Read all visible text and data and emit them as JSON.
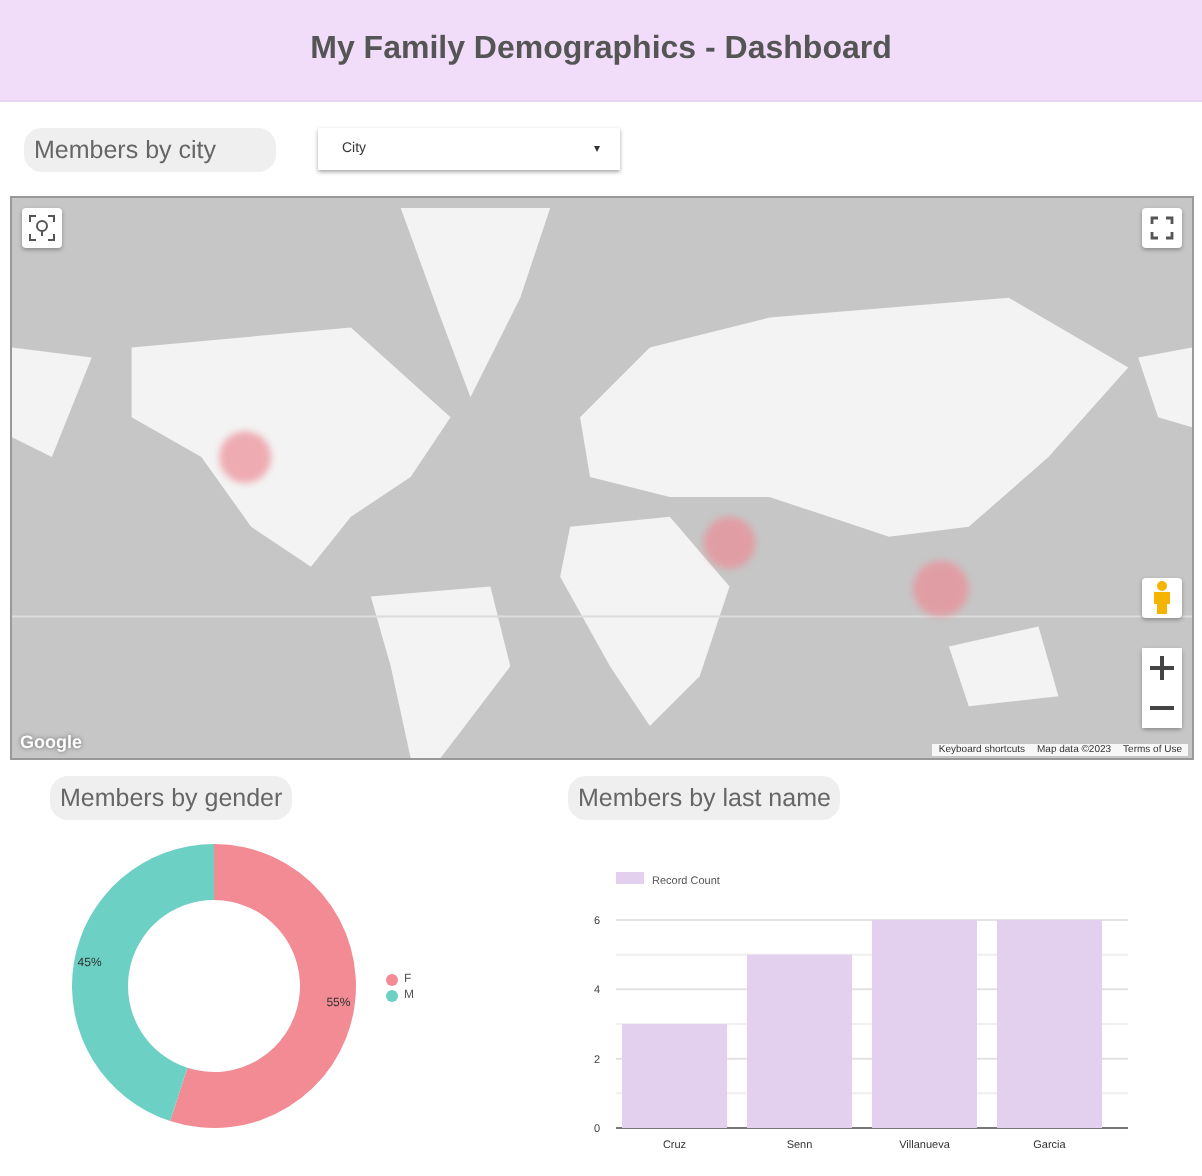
{
  "header": {
    "title": "My Family Demographics - Dashboard"
  },
  "city_section": {
    "title": "Members by city",
    "dropdown": {
      "value": "City",
      "caret": "▾"
    }
  },
  "map": {
    "kind": "picture",
    "logo": "Google",
    "attribution": [
      "Keyboard shortcuts",
      "Map data ©2023",
      "Terms of Use"
    ]
  },
  "gender_section": {
    "title": "Members by gender",
    "chart_data": {
      "type": "donut",
      "categories": [
        "F",
        "M"
      ],
      "values": [
        55,
        45
      ],
      "colors": [
        "#f28b93",
        "#6dd0c5"
      ],
      "value_labels": [
        "55%",
        "45%"
      ],
      "legend": "right"
    }
  },
  "lastname_section": {
    "title": "Members by last name",
    "chart_data": {
      "type": "bar",
      "categories": [
        "Cruz",
        "Senn",
        "Villanueva",
        "Garcia"
      ],
      "series": [
        {
          "name": "Record Count",
          "color": "#e2d0ee",
          "values": [
            3,
            5,
            6,
            6
          ]
        }
      ],
      "ylim": [
        0,
        6
      ],
      "yticks": [
        0,
        2,
        4,
        6
      ]
    }
  }
}
